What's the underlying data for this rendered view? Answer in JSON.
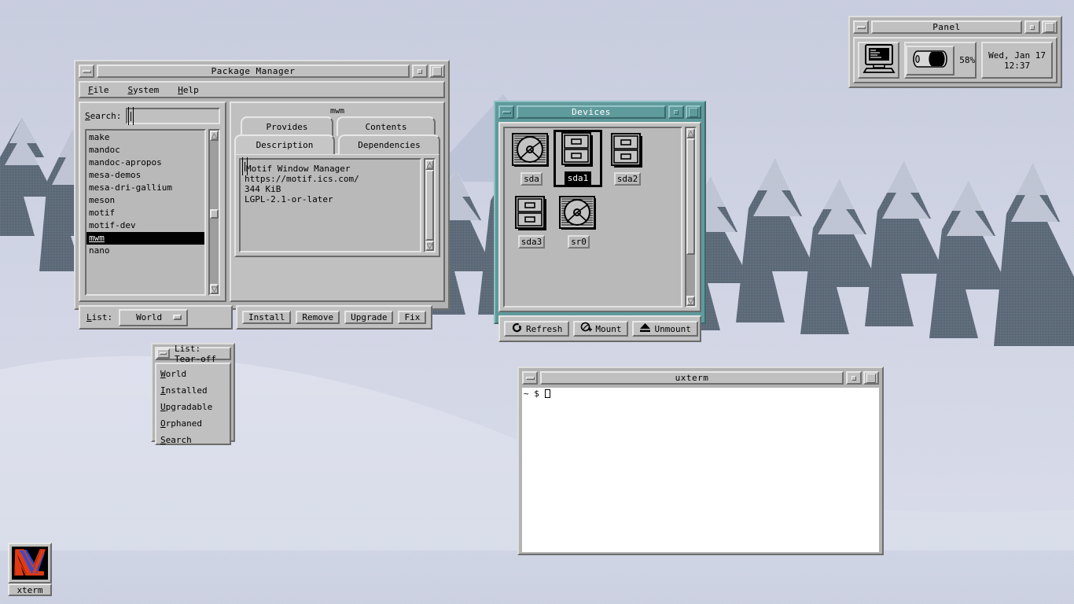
{
  "desktop": {
    "wallpaper_alt": "snowy forest photograph, dithered",
    "colors": {
      "face": "#c0c0c0",
      "title_active_teal": "#5f9a9c",
      "snow": "#cfd4e4",
      "tree_dark": "#3d4c5c",
      "selection": "#000000"
    },
    "icon": {
      "label": "xterm",
      "icon": "x-logo-icon"
    }
  },
  "package_manager": {
    "title": "Package Manager",
    "menus": [
      "File",
      "System",
      "Help"
    ],
    "search": {
      "label": "Search:",
      "value": "",
      "placeholder": ""
    },
    "packages": [
      "make",
      "mandoc",
      "mandoc-apropos",
      "mesa-demos",
      "mesa-dri-gallium",
      "meson",
      "motif",
      "motif-dev",
      "mwm",
      "nano"
    ],
    "selected_package": "mwm",
    "list_label": "List:",
    "list_value": "World",
    "list_options": [
      "World",
      "Installed",
      "Upgradable",
      "Orphaned",
      "Search"
    ],
    "notebook_title": "mwm",
    "tabs_top": [
      "Provides",
      "Contents"
    ],
    "tabs_bottom": [
      "Description",
      "Dependencies"
    ],
    "active_tab": "Description",
    "description_lines": [
      "Motif Window Manager",
      "https://motif.ics.com/",
      "344 KiB",
      "LGPL-2.1-or-later"
    ],
    "actions": [
      "Install",
      "Remove",
      "Upgrade",
      "Fix"
    ]
  },
  "devices": {
    "title": "Devices",
    "items": [
      {
        "name": "sda",
        "kind": "disk-icon",
        "selected": false
      },
      {
        "name": "sda1",
        "kind": "partition-icon",
        "selected": true
      },
      {
        "name": "sda2",
        "kind": "partition-icon",
        "selected": false
      },
      {
        "name": "sda3",
        "kind": "partition-icon",
        "selected": false
      },
      {
        "name": "sr0",
        "kind": "disk-icon",
        "selected": false
      }
    ],
    "actions": [
      {
        "label": "Refresh",
        "icon": "refresh-icon"
      },
      {
        "label": "Mount",
        "icon": "mount-icon"
      },
      {
        "label": "Unmount",
        "icon": "eject-icon"
      }
    ]
  },
  "panel": {
    "title": "Panel",
    "launcher_icon": "computer-icon",
    "battery_icon": "battery-icon",
    "battery_percent": "58%",
    "clock_date": "Wed, Jan 17",
    "clock_time": "12:37"
  },
  "tearoff_menu": {
    "title": "List: Tear-off",
    "items": [
      "World",
      "Installed",
      "Upgradable",
      "Orphaned",
      "Search"
    ]
  },
  "uxterm": {
    "title": "uxterm",
    "prompt": "~ $ "
  }
}
